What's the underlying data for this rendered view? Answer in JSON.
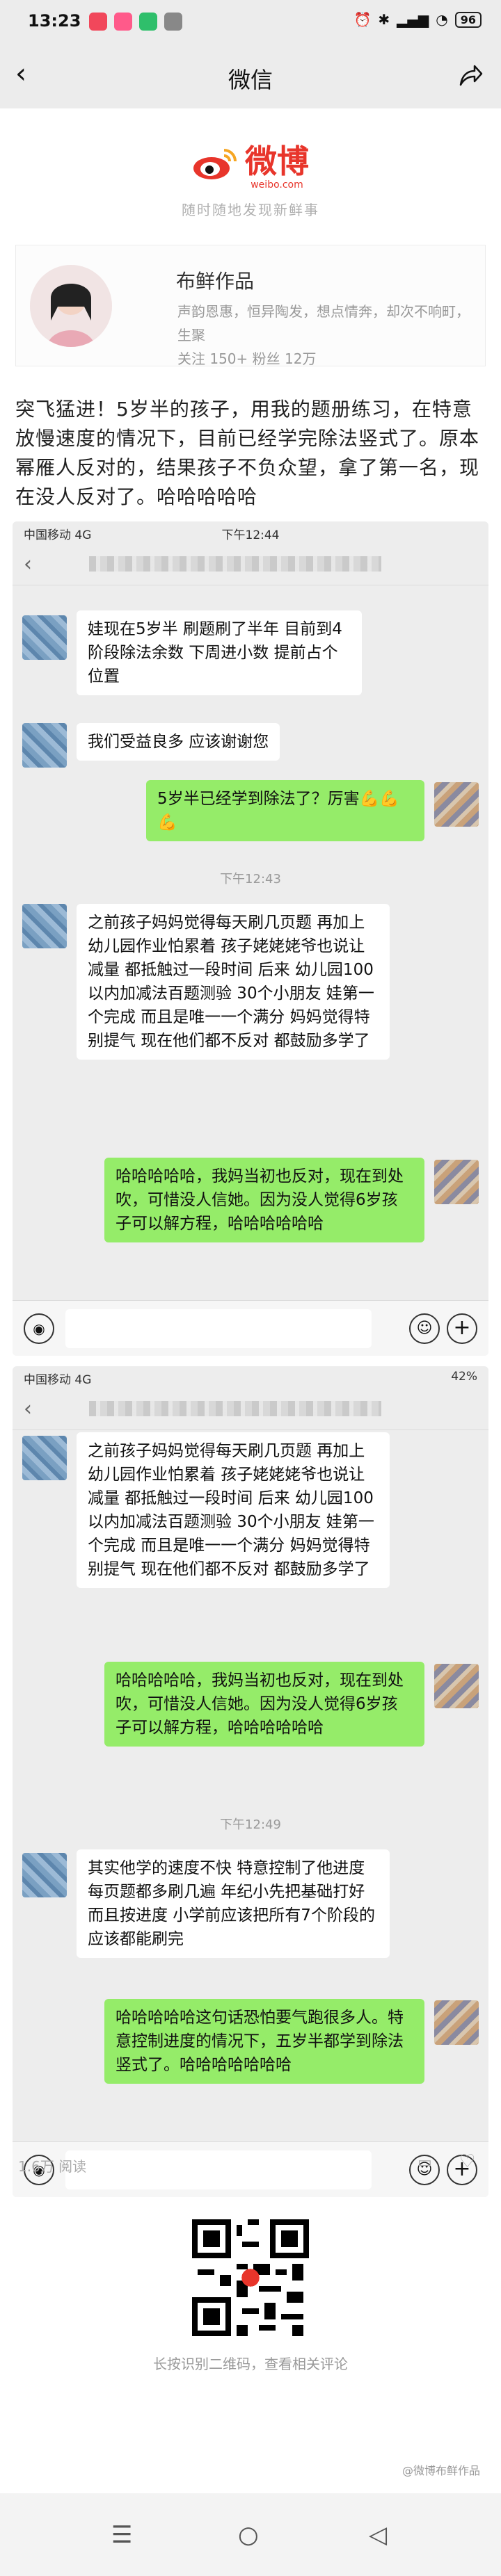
{
  "status_bar": {
    "time": "13:23",
    "battery": "96"
  },
  "nav": {
    "title": "微信"
  },
  "weibo": {
    "brand": "微博",
    "domain": "weibo.com",
    "slogan": "随时随地发现新鲜事"
  },
  "profile": {
    "name": "布鲜作品",
    "desc_line1": "声韵恩惠，恒异陶发，想点情奔，却次不响町，生聚",
    "desc_line2": "关注 150+   粉丝 12万"
  },
  "body": "突飞猛进！5岁半的孩子，用我的题册练习，在特意放慢速度的情况下，目前已经学完除法竖式了。原本幂雁人反对的，结果孩子不负众望，拿了第一名，现在没人反对了。哈哈哈哈哈",
  "chat1": {
    "status_left": "中国移动 4G",
    "status_time": "下午12:44",
    "back": "‹",
    "messages": [
      "娃现在5岁半 刷题刷了半年 目前到4阶段除法余数 下周进小数 提前占个位置",
      "我们受益良多 应该谢谢您",
      "5岁半已经学到除法了？厉害💪💪💪",
      "之前孩子妈妈觉得每天刷几页题 再加上幼儿园作业怕累着 孩子姥姥姥爷也说让减量 都抵触过一段时间 后来 幼儿园100以内加减法百题测验 30个小朋友 娃第一个完成 而且是唯一一个满分 妈妈觉得特别提气 现在他们都不反对 都鼓励多学了",
      "哈哈哈哈哈，我妈当初也反对，现在到处吹，可惜没人信她。因为没人觉得6岁孩子可以解方程，哈哈哈哈哈哈"
    ],
    "timestamp": "下午12:43"
  },
  "chat2": {
    "status_left": "中国移动 4G",
    "status_right": "42%",
    "messages": [
      "之前孩子妈妈觉得每天刷几页题 再加上幼儿园作业怕累着 孩子姥姥姥爷也说让减量 都抵触过一段时间 后来 幼儿园100以内加减法百题测验 30个小朋友 娃第一个完成 而且是唯一一个满分 妈妈觉得特别提气 现在他们都不反对 都鼓励多学了",
      "哈哈哈哈哈，我妈当初也反对，现在到处吹，可惜没人信她。因为没人觉得6岁孩子可以解方程，哈哈哈哈哈哈",
      "其实他学的速度不快 特意控制了他进度 每页题都多刷几遍 年纪小先把基础打好 而且按进度 小学前应该把所有7个阶段的应该都能刷完",
      "哈哈哈哈哈这句话恐怕要气跑很多人。特意控制进度的情况下，五岁半都学到除法竖式了。哈哈哈哈哈哈哈"
    ],
    "timestamp": "下午12:49"
  },
  "footer": {
    "views": "1.6万 阅读",
    "qr_caption": "长按识别二维码，查看相关评论",
    "watermark": "@微博布鲜作品"
  }
}
